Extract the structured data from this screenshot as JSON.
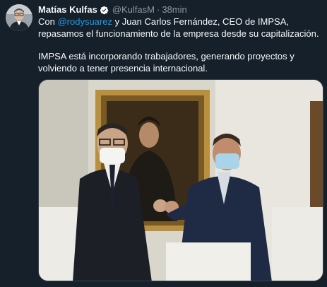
{
  "tweet": {
    "author_name": "Matías Kulfas",
    "handle": "@KulfasM",
    "separator": "·",
    "time": "38min",
    "text_line1_prefix": "Con ",
    "mention": "@rodysuarez",
    "text_line1_suffix": " y Juan Carlos Fernández, CEO de IMPSA, repasamos el funcionamiento de la empresa desde su capitalización.",
    "text_line2": "IMPSA está incorporando trabajadores, generando proyectos y volviendo a tener presencia internacional."
  },
  "icons": {
    "verified": "verified-badge-icon"
  },
  "colors": {
    "background": "#15202b",
    "text": "#f7f9f9",
    "secondary": "#8b98a5",
    "accent": "#1d9bf0"
  }
}
